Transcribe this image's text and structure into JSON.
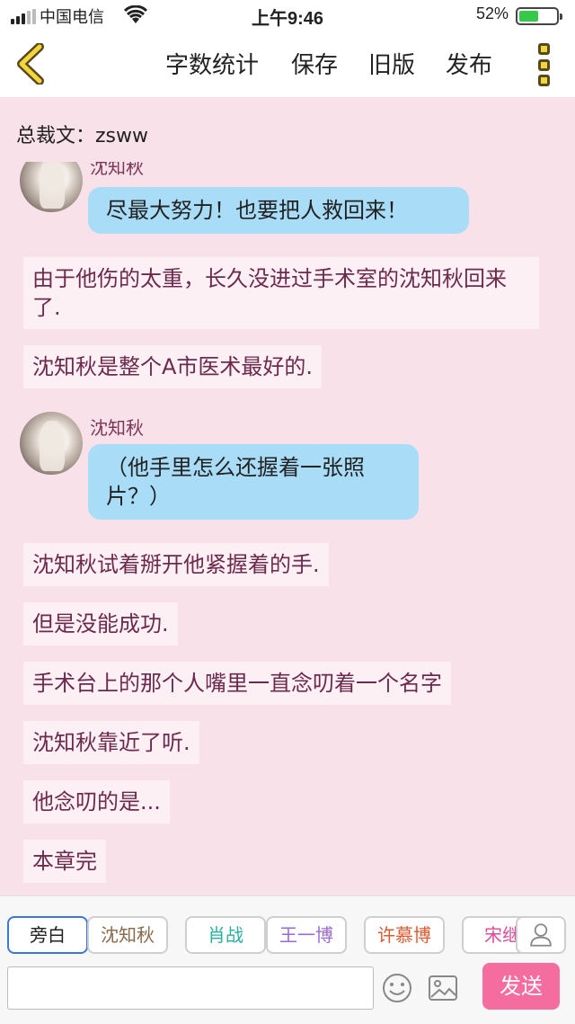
{
  "status_bar": {
    "carrier": "中国电信",
    "time": "上午9:46",
    "battery_percent": "52%",
    "battery_level": 0.52,
    "battery_color": "#36c84a"
  },
  "nav": {
    "back_icon": "chevron-left-icon",
    "items": [
      "字数统计",
      "保存",
      "旧版",
      "发布"
    ],
    "more_icon": "more-vertical-icon"
  },
  "author_line": "总裁文：zsww",
  "messages": [
    {
      "type": "dialogue",
      "speaker": "沈知秋",
      "text": "尽最大努力！也要把人救回来！"
    },
    {
      "type": "narration",
      "text": "由于他伤的太重，长久没进过手术室的沈知秋回来了."
    },
    {
      "type": "narration",
      "text": "沈知秋是整个A市医术最好的."
    },
    {
      "type": "dialogue",
      "speaker": "沈知秋",
      "text": "（他手里怎么还握着一张照片？）"
    },
    {
      "type": "narration",
      "text": "沈知秋试着掰开他紧握着的手."
    },
    {
      "type": "narration",
      "text": "但是没能成功."
    },
    {
      "type": "narration",
      "text": "手术台上的那个人嘴里一直念叨着一个名字"
    },
    {
      "type": "narration",
      "text": "沈知秋靠近了听."
    },
    {
      "type": "narration",
      "text": "他念叨的是..."
    },
    {
      "type": "narration",
      "text": "本章完"
    }
  ],
  "roles": [
    {
      "label": "旁白",
      "color": "#222222"
    },
    {
      "label": "沈知秋",
      "color": "#8a6a4a"
    },
    {
      "label": "肖战",
      "color": "#2ab0a0"
    },
    {
      "label": "王一博",
      "color": "#9a6ad0"
    },
    {
      "label": "许慕博",
      "color": "#e05a30"
    },
    {
      "label": "宋继",
      "color": "#e04a9a"
    }
  ],
  "input": {
    "value": "",
    "placeholder": ""
  },
  "send_label": "发送",
  "colors": {
    "background": "#f9e1e9",
    "bubble": "#a9dcf7",
    "narration_text": "#6d2a4c",
    "send_button": "#f56c9f",
    "nav_accent": "#f2d640"
  }
}
